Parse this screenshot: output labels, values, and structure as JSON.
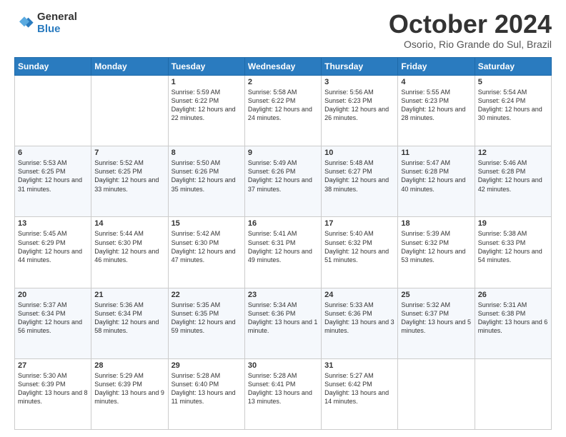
{
  "header": {
    "logo_general": "General",
    "logo_blue": "Blue",
    "month_title": "October 2024",
    "location": "Osorio, Rio Grande do Sul, Brazil"
  },
  "days_of_week": [
    "Sunday",
    "Monday",
    "Tuesday",
    "Wednesday",
    "Thursday",
    "Friday",
    "Saturday"
  ],
  "weeks": [
    [
      {
        "day": "",
        "info": ""
      },
      {
        "day": "",
        "info": ""
      },
      {
        "day": "1",
        "info": "Sunrise: 5:59 AM\nSunset: 6:22 PM\nDaylight: 12 hours and 22 minutes."
      },
      {
        "day": "2",
        "info": "Sunrise: 5:58 AM\nSunset: 6:22 PM\nDaylight: 12 hours and 24 minutes."
      },
      {
        "day": "3",
        "info": "Sunrise: 5:56 AM\nSunset: 6:23 PM\nDaylight: 12 hours and 26 minutes."
      },
      {
        "day": "4",
        "info": "Sunrise: 5:55 AM\nSunset: 6:23 PM\nDaylight: 12 hours and 28 minutes."
      },
      {
        "day": "5",
        "info": "Sunrise: 5:54 AM\nSunset: 6:24 PM\nDaylight: 12 hours and 30 minutes."
      }
    ],
    [
      {
        "day": "6",
        "info": "Sunrise: 5:53 AM\nSunset: 6:25 PM\nDaylight: 12 hours and 31 minutes."
      },
      {
        "day": "7",
        "info": "Sunrise: 5:52 AM\nSunset: 6:25 PM\nDaylight: 12 hours and 33 minutes."
      },
      {
        "day": "8",
        "info": "Sunrise: 5:50 AM\nSunset: 6:26 PM\nDaylight: 12 hours and 35 minutes."
      },
      {
        "day": "9",
        "info": "Sunrise: 5:49 AM\nSunset: 6:26 PM\nDaylight: 12 hours and 37 minutes."
      },
      {
        "day": "10",
        "info": "Sunrise: 5:48 AM\nSunset: 6:27 PM\nDaylight: 12 hours and 38 minutes."
      },
      {
        "day": "11",
        "info": "Sunrise: 5:47 AM\nSunset: 6:28 PM\nDaylight: 12 hours and 40 minutes."
      },
      {
        "day": "12",
        "info": "Sunrise: 5:46 AM\nSunset: 6:28 PM\nDaylight: 12 hours and 42 minutes."
      }
    ],
    [
      {
        "day": "13",
        "info": "Sunrise: 5:45 AM\nSunset: 6:29 PM\nDaylight: 12 hours and 44 minutes."
      },
      {
        "day": "14",
        "info": "Sunrise: 5:44 AM\nSunset: 6:30 PM\nDaylight: 12 hours and 46 minutes."
      },
      {
        "day": "15",
        "info": "Sunrise: 5:42 AM\nSunset: 6:30 PM\nDaylight: 12 hours and 47 minutes."
      },
      {
        "day": "16",
        "info": "Sunrise: 5:41 AM\nSunset: 6:31 PM\nDaylight: 12 hours and 49 minutes."
      },
      {
        "day": "17",
        "info": "Sunrise: 5:40 AM\nSunset: 6:32 PM\nDaylight: 12 hours and 51 minutes."
      },
      {
        "day": "18",
        "info": "Sunrise: 5:39 AM\nSunset: 6:32 PM\nDaylight: 12 hours and 53 minutes."
      },
      {
        "day": "19",
        "info": "Sunrise: 5:38 AM\nSunset: 6:33 PM\nDaylight: 12 hours and 54 minutes."
      }
    ],
    [
      {
        "day": "20",
        "info": "Sunrise: 5:37 AM\nSunset: 6:34 PM\nDaylight: 12 hours and 56 minutes."
      },
      {
        "day": "21",
        "info": "Sunrise: 5:36 AM\nSunset: 6:34 PM\nDaylight: 12 hours and 58 minutes."
      },
      {
        "day": "22",
        "info": "Sunrise: 5:35 AM\nSunset: 6:35 PM\nDaylight: 12 hours and 59 minutes."
      },
      {
        "day": "23",
        "info": "Sunrise: 5:34 AM\nSunset: 6:36 PM\nDaylight: 13 hours and 1 minute."
      },
      {
        "day": "24",
        "info": "Sunrise: 5:33 AM\nSunset: 6:36 PM\nDaylight: 13 hours and 3 minutes."
      },
      {
        "day": "25",
        "info": "Sunrise: 5:32 AM\nSunset: 6:37 PM\nDaylight: 13 hours and 5 minutes."
      },
      {
        "day": "26",
        "info": "Sunrise: 5:31 AM\nSunset: 6:38 PM\nDaylight: 13 hours and 6 minutes."
      }
    ],
    [
      {
        "day": "27",
        "info": "Sunrise: 5:30 AM\nSunset: 6:39 PM\nDaylight: 13 hours and 8 minutes."
      },
      {
        "day": "28",
        "info": "Sunrise: 5:29 AM\nSunset: 6:39 PM\nDaylight: 13 hours and 9 minutes."
      },
      {
        "day": "29",
        "info": "Sunrise: 5:28 AM\nSunset: 6:40 PM\nDaylight: 13 hours and 11 minutes."
      },
      {
        "day": "30",
        "info": "Sunrise: 5:28 AM\nSunset: 6:41 PM\nDaylight: 13 hours and 13 minutes."
      },
      {
        "day": "31",
        "info": "Sunrise: 5:27 AM\nSunset: 6:42 PM\nDaylight: 13 hours and 14 minutes."
      },
      {
        "day": "",
        "info": ""
      },
      {
        "day": "",
        "info": ""
      }
    ]
  ]
}
